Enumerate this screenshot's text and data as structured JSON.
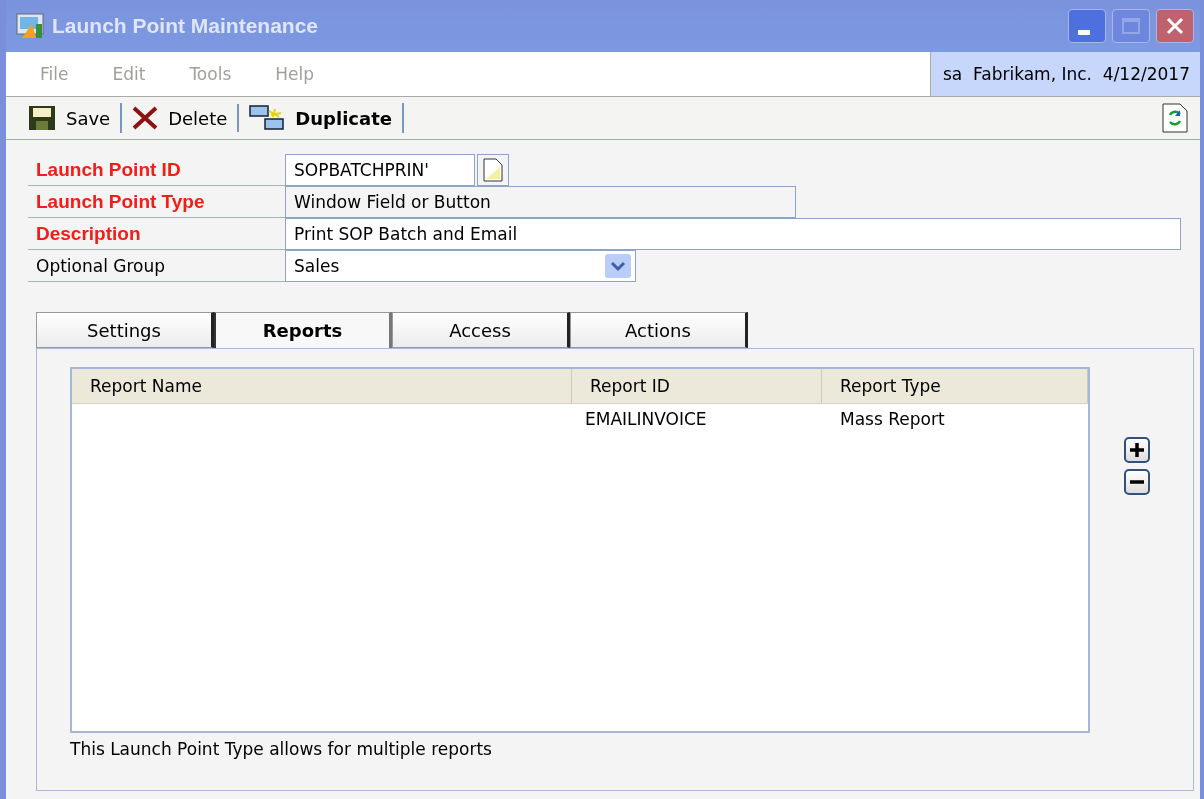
{
  "window": {
    "title": "Launch Point Maintenance"
  },
  "menu": [
    "File",
    "Edit",
    "Tools",
    "Help"
  ],
  "user_info": "sa  Fabrikam, Inc.  4/12/2017",
  "toolbar": [
    {
      "kind": "save",
      "label": "Save"
    },
    {
      "kind": "delete",
      "label": "Delete"
    },
    {
      "kind": "duplicate",
      "label": "Duplicate"
    }
  ],
  "form": [
    {
      "label": "Launch Point  ID",
      "required": true,
      "kind": "id",
      "value": "SOPBATCHPRIN'"
    },
    {
      "label": "Launch Point Type",
      "required": true,
      "kind": "readonly",
      "value": "Window Field or Button"
    },
    {
      "label": "Description",
      "required": true,
      "kind": "text",
      "value": "Print SOP Batch and Email"
    },
    {
      "label": "Optional Group",
      "required": false,
      "kind": "dropdown",
      "value": "Sales"
    }
  ],
  "tabs": [
    {
      "label": "Settings",
      "selected": false
    },
    {
      "label": "Reports",
      "selected": true
    },
    {
      "label": "Access",
      "selected": false
    },
    {
      "label": "Actions",
      "selected": false
    }
  ],
  "table": {
    "columns": [
      "Report Name",
      "Report ID",
      "Report Type"
    ],
    "rows": [
      [
        "",
        "EMAILINVOICE",
        "Mass Report"
      ]
    ]
  },
  "note": "This Launch Point Type allows for multiple reports"
}
